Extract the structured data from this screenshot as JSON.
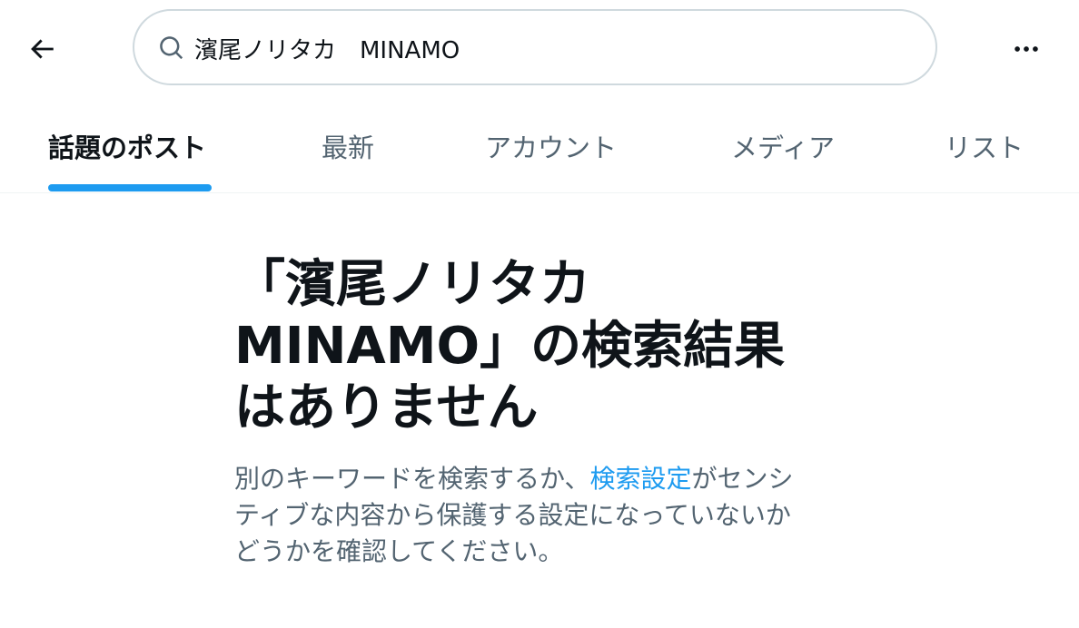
{
  "header": {
    "search_value": "濱尾ノリタカ　MINAMO"
  },
  "tabs": [
    {
      "label": "話題のポスト",
      "active": true
    },
    {
      "label": "最新",
      "active": false
    },
    {
      "label": "アカウント",
      "active": false
    },
    {
      "label": "メディア",
      "active": false
    },
    {
      "label": "リスト",
      "active": false
    }
  ],
  "empty_state": {
    "title_lines": [
      "「濱尾ノリタカ",
      "MINAMO」の検索結果",
      "はありません"
    ],
    "desc_line1_pre": "別のキーワードを検索するか、",
    "desc_link": "検索設定",
    "desc_line1_post": "がセンシ",
    "desc_line2": "ティブな内容から保護する設定になっていないか",
    "desc_line3": "どうかを確認してください。"
  },
  "icons": {
    "back": "arrow-left-icon",
    "search": "search-icon",
    "more": "more-icon"
  },
  "colors": {
    "accent": "#1d9bf0",
    "text_primary": "#0f1419",
    "text_secondary": "#536471",
    "border": "#cfd9de"
  }
}
